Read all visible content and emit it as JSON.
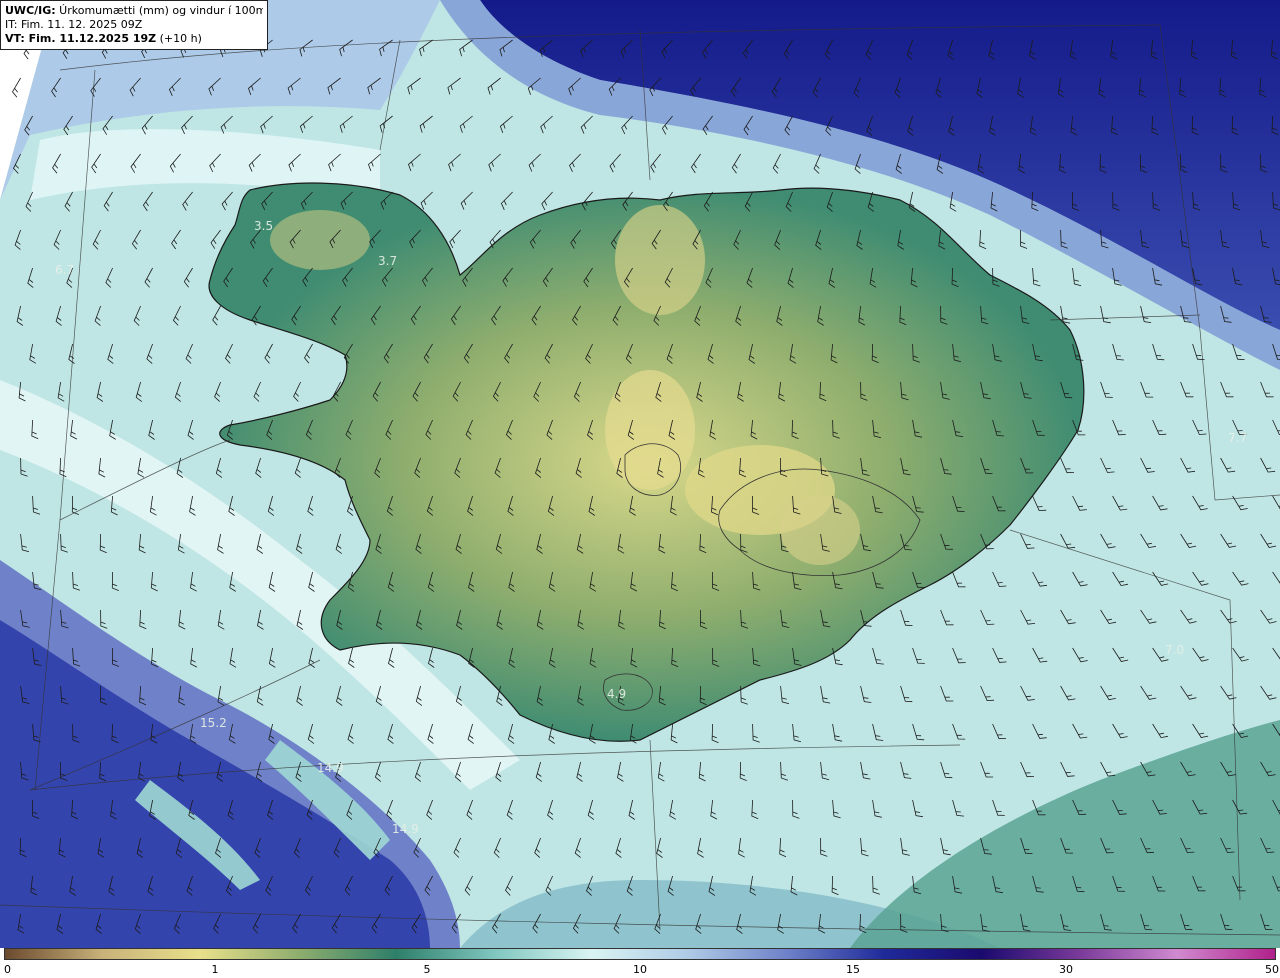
{
  "header": {
    "title_bold": "UWC/IG:",
    "title_rest": " Úrkomumætti (mm) og vindur í 100m hæð",
    "initial_time": "IT: Fim. 11. 12. 2025 09Z",
    "valid_bold": "VT: Fim. 11.12.2025 19Z",
    "valid_rest": " (+10 h)"
  },
  "colorbar": {
    "labels": [
      "0",
      "1",
      "5",
      "10",
      "15",
      "30",
      "50"
    ],
    "colors": [
      "#6b4a2e",
      "#c9b27a",
      "#e8e08a",
      "#8fae6e",
      "#2e7f6a",
      "#7fc6bf",
      "#d9f4f2",
      "#aecbe6",
      "#6f82c9",
      "#1f2a9a",
      "#1a0a6e",
      "#7a3a9a",
      "#d08ad0",
      "#b0208a"
    ]
  },
  "value_labels": [
    {
      "text": "3.5"
    },
    {
      "text": "3.7"
    },
    {
      "text": "6.7"
    },
    {
      "text": "4.9"
    },
    {
      "text": "15.2"
    },
    {
      "text": "14.9"
    },
    {
      "text": "14.9"
    },
    {
      "text": "7.0"
    },
    {
      "text": "7.7"
    }
  ]
}
